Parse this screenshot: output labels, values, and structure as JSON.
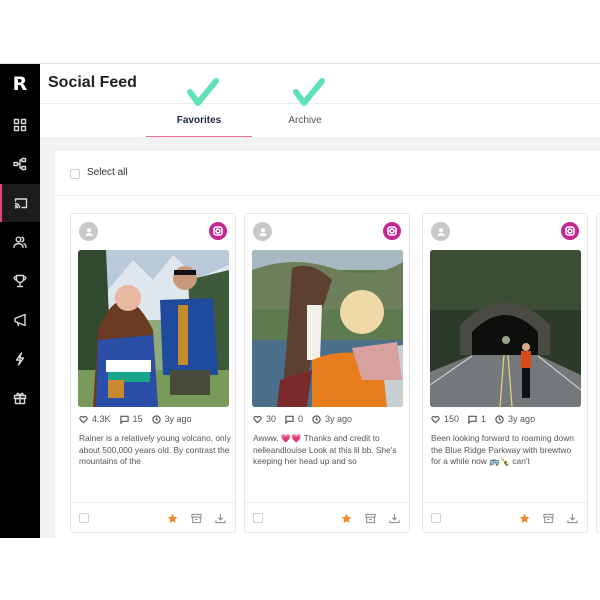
{
  "app": {
    "logo": "R",
    "title": "Social Feed"
  },
  "sidebar": {
    "items": [
      {
        "icon": "dashboard-grid-icon",
        "active": false
      },
      {
        "icon": "hierarchy-icon",
        "active": false
      },
      {
        "icon": "cast-icon",
        "active": true
      },
      {
        "icon": "users-icon",
        "active": false
      },
      {
        "icon": "trophy-icon",
        "active": false
      },
      {
        "icon": "megaphone-icon",
        "active": false
      },
      {
        "icon": "lightning-icon",
        "active": false
      },
      {
        "icon": "gift-icon",
        "active": false
      }
    ]
  },
  "tabs": [
    {
      "label": "Favorites",
      "active": true
    },
    {
      "label": "Archive",
      "active": false
    }
  ],
  "annotations": {
    "checkmark_color": "#5fe3b2"
  },
  "select_all": {
    "label": "Select all",
    "checked": false
  },
  "colors": {
    "accent": "#f06b95",
    "instagram": "#c2288f",
    "favorite_star": "#f08a24"
  },
  "posts": [
    {
      "source": "instagram",
      "likes": "4.3K",
      "comments": "15",
      "time": "3y ago",
      "caption": "Rainer is a relatively young volcano, only about 500,000 years old. By contrast the mountains of the",
      "favorited": true,
      "image_desc": "Couple hiking in front of snowy mountains"
    },
    {
      "source": "instagram",
      "likes": "30",
      "comments": "0",
      "time": "3y ago",
      "caption": "Awww. 💗💗 Thanks and credit to nelleandlouise Look at this lil bb. She's keeping her head up and so",
      "favorited": true,
      "image_desc": "Woman hugging a dog by a lake"
    },
    {
      "source": "instagram",
      "likes": "150",
      "comments": "1",
      "time": "3y ago",
      "caption": "Been looking forward to roaming down the Blue Ridge Parkway with brewtwo for a while now 🚌🍾 can't",
      "favorited": true,
      "image_desc": "Woman walking on a road in front of a tunnel"
    }
  ]
}
